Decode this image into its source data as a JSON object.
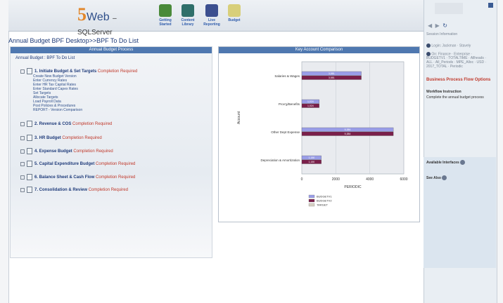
{
  "app": {
    "logo_number": "5",
    "logo_web": "Web",
    "logo_separator": "–",
    "logo_db": "SQLServer",
    "toolbar": [
      {
        "label1": "Getting",
        "label2": "Started",
        "icon": "house-icon"
      },
      {
        "label1": "Content",
        "label2": "Library",
        "icon": "book-icon"
      },
      {
        "label1": "Live",
        "label2": "Reporting",
        "icon": "report-icon"
      },
      {
        "label1": "Budget",
        "label2": "",
        "icon": "budget-icon"
      }
    ]
  },
  "breadcrumb": "Annual Budget BPF Desktop>>BPF To Do List",
  "left_panel": {
    "header": "Annual Budget Process",
    "title": "Annual Budget : BPF To Do List",
    "tasks": [
      {
        "label": "1. Initiate Budget & Set Targets",
        "status": "Completion Required",
        "subtasks": [
          "Create New Budget Version",
          "Enter Currency Rates",
          "Enter HR Tax Capital Rates",
          "Enter Standard Capex Rates",
          "Set Targets",
          "Allocate Targets",
          "Load Payroll Data",
          "Post Policies & Procedures",
          "REPORT - Version Comparison"
        ]
      },
      {
        "label": "2. Revenue & COS",
        "status": "Completion Required",
        "subtasks": []
      },
      {
        "label": "3. HR Budget",
        "status": "Completion Required",
        "subtasks": []
      },
      {
        "label": "4. Expense Budget",
        "status": "Completion Required",
        "subtasks": []
      },
      {
        "label": "5. Capital Expenditure Budget",
        "status": "Completion Required",
        "subtasks": []
      },
      {
        "label": "6. Balance Sheet & Cash Flow",
        "status": "Completion Required",
        "subtasks": []
      },
      {
        "label": "7. Consolidation & Review",
        "status": "Completion Required",
        "subtasks": []
      }
    ]
  },
  "chart_panel": {
    "header": "Key Account Comparison"
  },
  "chart_data": {
    "type": "bar",
    "orientation": "horizontal",
    "categories": [
      "Salaries & Wages",
      "Prov'g/Benefits",
      "Other Dept Expense",
      "Depreciation & Amortization"
    ],
    "series": [
      {
        "name": "BUDGETV1",
        "values": [
          3500,
          1024,
          5384,
          1150
        ],
        "labels": [
          "3,581",
          "1,024",
          "5,384",
          "1,150"
        ]
      },
      {
        "name": "BUDGETV2",
        "values": [
          3500,
          1024,
          5384,
          1150
        ],
        "labels": [
          "3,581",
          "1,024",
          "5,384",
          "1,150"
        ]
      },
      {
        "name": "TARGET",
        "values": [
          0,
          0,
          0,
          0
        ],
        "labels": [
          "",
          "",
          "",
          ""
        ]
      }
    ],
    "xlabel": "PERIODIC",
    "ylabel": "Account",
    "xlim": [
      0,
      6000
    ],
    "xticks": [
      "0",
      "2000",
      "4000",
      "6000"
    ],
    "grid": true,
    "legend": "bottom",
    "colors": {
      "BUDGETV1": "#9a9ee8",
      "BUDGETV2": "#7a1f4a",
      "TARGET": "#d8d1c4"
    }
  },
  "right_panel": {
    "session_header": "Session Information",
    "session_lines": [
      "Login: Jackman · Stavely",
      "On: Finance · Enterprise · BUDGETV1 · TOTALTIME · Allheads · ALL · All_Periods · MPE_Alloc · USD · 2017_TOTAL · Periodic"
    ],
    "bpf_header": "Business Process Flow Options",
    "workflow_title": "Workflow Instruction",
    "workflow_text": "Complete the annual budget process",
    "available_interfaces": "Available Interfaces",
    "see_also": "See Also"
  },
  "colors": {
    "accent": "#4f78b0",
    "required": "#c0392b",
    "link": "#203c7b"
  }
}
